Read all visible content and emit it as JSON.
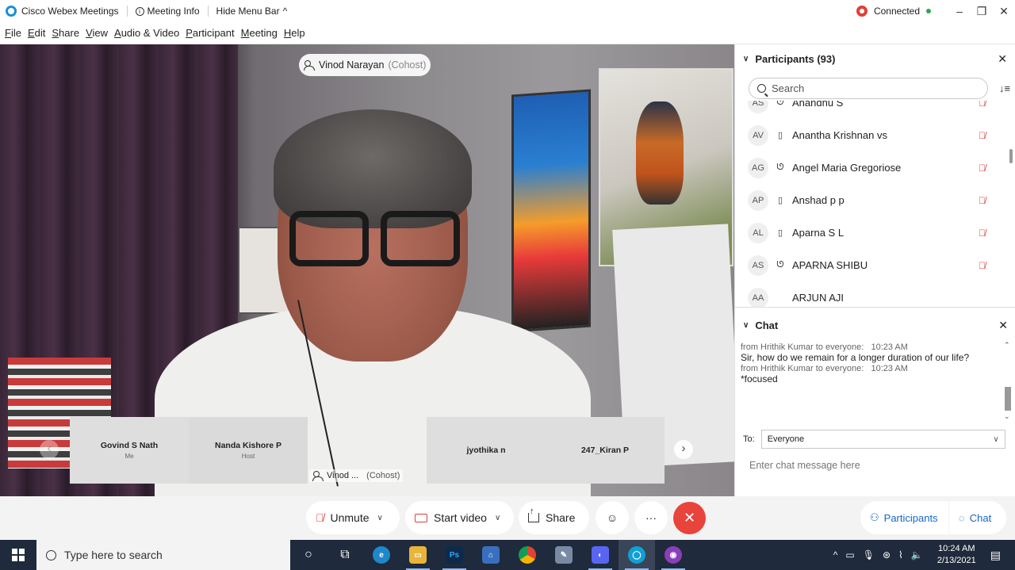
{
  "window": {
    "app_title": "Cisco Webex Meetings",
    "meeting_info": "Meeting Info",
    "hide_menu_bar": "Hide Menu Bar",
    "connection_status": "Connected"
  },
  "menubar": {
    "items": [
      {
        "first": "F",
        "rest": "ile"
      },
      {
        "first": "E",
        "rest": "dit"
      },
      {
        "first": "S",
        "rest": "hare"
      },
      {
        "first": "V",
        "rest": "iew"
      },
      {
        "first": "A",
        "rest": "udio & Video"
      },
      {
        "first": "P",
        "rest": "articipant"
      },
      {
        "first": "M",
        "rest": "eeting"
      },
      {
        "first": "H",
        "rest": "elp"
      }
    ]
  },
  "active_speaker": {
    "name": "Vinod Narayan",
    "role": "(Cohost)"
  },
  "filmstrip": {
    "tiles": [
      {
        "name": "Govind S Nath",
        "sub": "Me"
      },
      {
        "name": "Nanda Kishore P",
        "sub": "Host"
      },
      {
        "name": "Vinod ...",
        "sub": "(Cohost)"
      },
      {
        "name": "jyothika n",
        "sub": ""
      },
      {
        "name": "247_Kiran P",
        "sub": ""
      }
    ]
  },
  "participants_panel": {
    "title": "Participants (93)",
    "search_placeholder": "Search",
    "list": [
      {
        "initials": "AS",
        "name": "Anandhu S",
        "device": "headset",
        "muted": true
      },
      {
        "initials": "AV",
        "name": "Anantha Krishnan vs",
        "device": "phone",
        "muted": true
      },
      {
        "initials": "AG",
        "name": "Angel Maria Gregoriose",
        "device": "headset",
        "muted": true
      },
      {
        "initials": "AP",
        "name": "Anshad p p",
        "device": "phone",
        "muted": true
      },
      {
        "initials": "AL",
        "name": "Aparna S L",
        "device": "phone",
        "muted": true
      },
      {
        "initials": "AS",
        "name": "APARNA SHIBU",
        "device": "headset",
        "muted": true
      },
      {
        "initials": "AA",
        "name": "ARJUN AJI",
        "device": "",
        "muted": false
      }
    ]
  },
  "chat_panel": {
    "title": "Chat",
    "messages": [
      {
        "meta": "from Hrithik Kumar to everyone:",
        "time": "10:23 AM",
        "text": "Sir, how do we remain for a longer duration of our life?"
      },
      {
        "meta": "from Hrithik Kumar to everyone:",
        "time": "10:23 AM",
        "text": "*focused"
      }
    ],
    "to_label": "To:",
    "to_value": "Everyone",
    "input_placeholder": "Enter chat message here"
  },
  "controls": {
    "unmute": "Unmute",
    "start_video": "Start video",
    "share": "Share",
    "participants": "Participants",
    "chat": "Chat"
  },
  "taskbar": {
    "search_placeholder": "Type here to search",
    "time": "10:24 AM",
    "date": "2/13/2021"
  },
  "colors": {
    "accent_blue": "#1766c4",
    "end_red": "#e8443c",
    "mute_red": "#e0403a",
    "connected_green": "#2ca94c"
  }
}
